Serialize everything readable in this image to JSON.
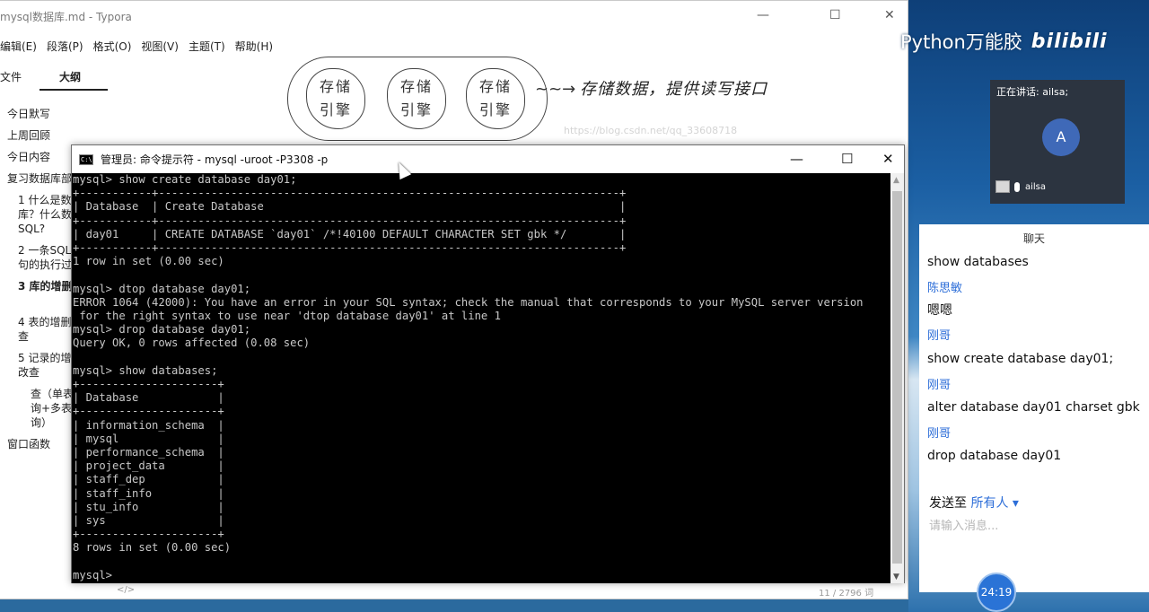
{
  "typora": {
    "title": "mysql数据库.md - Typora",
    "menu": [
      "编辑(E)",
      "段落(P)",
      "格式(O)",
      "视图(V)",
      "主题(T)",
      "帮助(H)"
    ],
    "tabs": {
      "files": "文件",
      "outline": "大纲"
    },
    "outline": [
      "今日默写",
      "上周回顾",
      "今日内容",
      "复习数据库部",
      "1 什么是数",
      "库？什么数",
      "SQL?",
      "2 一条SQL",
      "句的执行过",
      "3 库的增删",
      "4 表的增删",
      "查",
      "5 记录的增",
      "改查",
      "查（单表",
      "询+多表",
      "询）",
      "窗口函数"
    ],
    "status_right": "11 / 2796 词",
    "status_left": "</>"
  },
  "drawing": {
    "engines": [
      "存储\n引擎",
      "存储\n引擎",
      "存储\n引擎"
    ],
    "arrow": "~~→",
    "note": "存储数据，提供读写接口",
    "watermark": "https://blog.csdn.net/qq_33608718"
  },
  "cmd": {
    "title": "管理员: 命令提示符 - mysql  -uroot -P3308 -p",
    "icon_label": "C:\\",
    "lines": [
      "mysql> show create database day01;",
      "+-----------+----------------------------------------------------------------------+",
      "| Database  | Create Database                                                      |",
      "+-----------+----------------------------------------------------------------------+",
      "| day01     | CREATE DATABASE `day01` /*!40100 DEFAULT CHARACTER SET gbk */        |",
      "+-----------+----------------------------------------------------------------------+",
      "1 row in set (0.00 sec)",
      "",
      "mysql> dtop database day01;",
      "ERROR 1064 (42000): You have an error in your SQL syntax; check the manual that corresponds to your MySQL server version",
      " for the right syntax to use near 'dtop database day01' at line 1",
      "mysql> drop database day01;",
      "Query OK, 0 rows affected (0.08 sec)",
      "",
      "mysql> show databases;",
      "+---------------------+",
      "| Database            |",
      "+---------------------+",
      "| information_schema  |",
      "| mysql               |",
      "| performance_schema  |",
      "| project_data        |",
      "| staff_dep           |",
      "| staff_info          |",
      "| stu_info            |",
      "| sys                 |",
      "+---------------------+",
      "8 rows in set (0.00 sec)",
      "",
      "mysql>"
    ]
  },
  "meeting": {
    "brand": "Python万能胶",
    "brand_logo": "bilibili",
    "speaking_label": "正在讲话: ailsa;",
    "avatar_letter": "A",
    "speaker_name": "ailsa",
    "chat_title": "聊天",
    "messages": [
      {
        "text": "show databases"
      },
      {
        "name": "陈思敏"
      },
      {
        "text": "嗯嗯"
      },
      {
        "name": "刚哥"
      },
      {
        "text": "show create database day01;"
      },
      {
        "name": "刚哥"
      },
      {
        "text": "alter database day01 charset gbk"
      },
      {
        "name": "刚哥"
      },
      {
        "text": "drop database day01"
      }
    ],
    "send_label": "发送至",
    "send_target": "所有人 ▾",
    "input_placeholder": "请输入消息...",
    "timer": "24:19"
  }
}
